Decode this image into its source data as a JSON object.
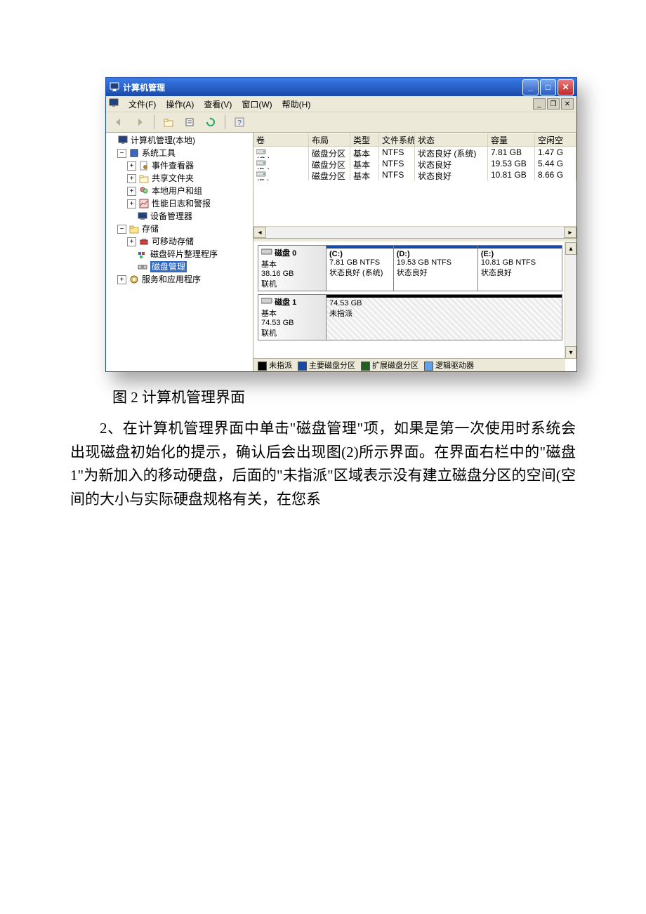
{
  "window": {
    "title": "计算机管理",
    "menu": {
      "file": "文件(F)",
      "action": "操作(A)",
      "view": "查看(V)",
      "window": "窗口(W)",
      "help": "帮助(H)"
    }
  },
  "tree": {
    "root": "计算机管理(本地)",
    "systools": "系统工具",
    "eventviewer": "事件查看器",
    "shared": "共享文件夹",
    "localusers": "本地用户和组",
    "perf": "性能日志和警报",
    "devmgr": "设备管理器",
    "storage": "存储",
    "removable": "可移动存储",
    "defrag": "磁盘碎片整理程序",
    "diskmgmt": "磁盘管理",
    "services": "服务和应用程序"
  },
  "columns": {
    "volume": "卷",
    "layout": "布局",
    "type": "类型",
    "fs": "文件系统",
    "status": "状态",
    "capacity": "容量",
    "free": "空闲空"
  },
  "volumes": [
    {
      "name": "(C:)",
      "layout": "磁盘分区",
      "type": "基本",
      "fs": "NTFS",
      "status": "状态良好 (系统)",
      "cap": "7.81 GB",
      "free": "1.47 G"
    },
    {
      "name": "(D:)",
      "layout": "磁盘分区",
      "type": "基本",
      "fs": "NTFS",
      "status": "状态良好",
      "cap": "19.53 GB",
      "free": "5.44 G"
    },
    {
      "name": "(E:)",
      "layout": "磁盘分区",
      "type": "基本",
      "fs": "NTFS",
      "status": "状态良好",
      "cap": "10.81 GB",
      "free": "8.66 G"
    }
  ],
  "disks": [
    {
      "title": "磁盘 0",
      "type": "基本",
      "size": "38.16 GB",
      "status": "联机",
      "parts": [
        {
          "label": "(C:)",
          "sub1": "7.81 GB NTFS",
          "sub2": "状态良好 (系统)",
          "kind": "primary"
        },
        {
          "label": "(D:)",
          "sub1": "19.53 GB NTFS",
          "sub2": "状态良好",
          "kind": "primary"
        },
        {
          "label": "(E:)",
          "sub1": "10.81 GB NTFS",
          "sub2": "状态良好",
          "kind": "primary"
        }
      ]
    },
    {
      "title": "磁盘 1",
      "type": "基本",
      "size": "74.53 GB",
      "status": "联机",
      "parts": [
        {
          "label": "",
          "sub1": "74.53 GB",
          "sub2": "未指派",
          "kind": "unalloc"
        }
      ]
    }
  ],
  "legend": {
    "unalloc": "未指派",
    "primary": "主要磁盘分区",
    "extended": "扩展磁盘分区",
    "logical": "逻辑驱动器"
  },
  "caption": "图 2  计算机管理界面",
  "body": "2、在计算机管理界面中单击\"磁盘管理\"项，如果是第一次使用时系统会出现磁盘初始化的提示，确认后会出现图(2)所示界面。在界面右栏中的\"磁盘 1\"为新加入的移动硬盘，后面的\"未指派\"区域表示没有建立磁盘分区的空间(空间的大小与实际硬盘规格有关，在您系"
}
